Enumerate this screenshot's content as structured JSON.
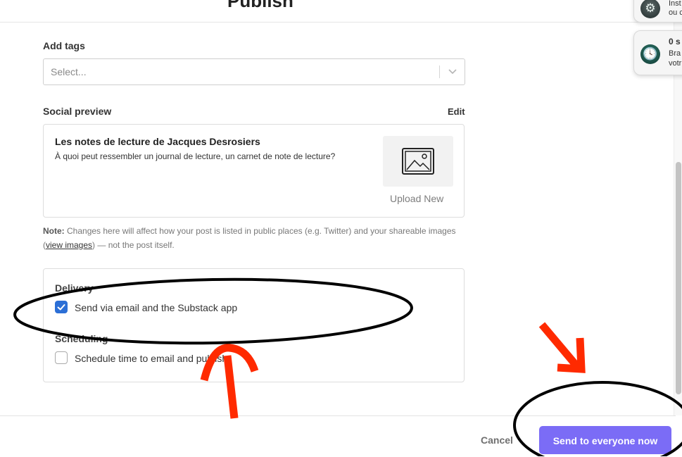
{
  "header": {
    "title": "Publish"
  },
  "notifications": [
    {
      "icon": "app-store-icon",
      "line1": "Inst",
      "line2": "ou c"
    },
    {
      "icon": "time-machine-icon",
      "line1": "0 s",
      "line2": "Bra",
      "line3": "votr"
    }
  ],
  "tags": {
    "label": "Add tags",
    "placeholder": "Select..."
  },
  "social_preview": {
    "label": "Social preview",
    "edit_label": "Edit",
    "post_title": "Les notes de lecture de Jacques Desrosiers",
    "post_subtitle": "À quoi peut ressembler un journal de lecture, un carnet de note de lecture?",
    "upload_label": "Upload New"
  },
  "note": {
    "prefix": "Note:",
    "text_before": " Changes here will affect how your post is listed in public places (e.g. Twitter) and your shareable images (",
    "link_text": "view images",
    "text_after": ") — not the post itself."
  },
  "delivery": {
    "heading": "Delivery",
    "option_label": "Send via email and the Substack app",
    "checked": true
  },
  "scheduling": {
    "heading": "Scheduling",
    "option_label": "Schedule time to email and publish",
    "checked": false
  },
  "footer": {
    "cancel_label": "Cancel",
    "send_label": "Send to everyone now"
  },
  "colors": {
    "accent": "#7b6cf6",
    "checkbox": "#2c6fd6",
    "annotation_arrow": "#ff2a00",
    "annotation_ellipse": "#000000"
  }
}
